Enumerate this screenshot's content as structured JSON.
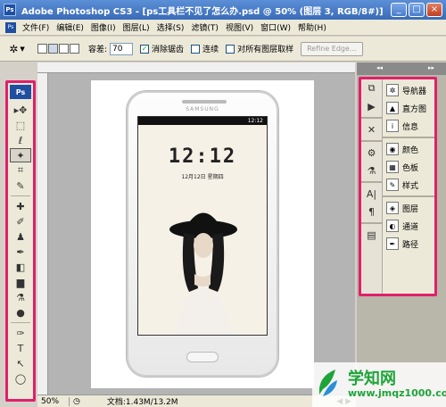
{
  "window": {
    "app_icon": "Ps",
    "title": "Adobe Photoshop CS3 - [ps工具栏不见了怎么办.psd @ 50% (图层 3, RGB/8#)]",
    "min": "_",
    "max": "□",
    "close": "×"
  },
  "menu": {
    "items": [
      "文件(F)",
      "编辑(E)",
      "图像(I)",
      "图层(L)",
      "选择(S)",
      "滤镜(T)",
      "视图(V)",
      "窗口(W)",
      "帮助(H)"
    ]
  },
  "options": {
    "tolerance_label": "容差:",
    "tolerance_value": "70",
    "antialias_label": "消除锯齿",
    "antialias_checked": true,
    "contiguous_label": "连续",
    "contiguous_checked": false,
    "all_layers_label": "对所有图层取样",
    "all_layers_checked": false,
    "refine_edge_label": "Refine Edge..."
  },
  "toolbox": {
    "logo": "Ps",
    "tools": [
      "▸✥",
      "⬚",
      "ℓ",
      "✦",
      "⌗",
      "✎",
      "✚",
      "✐",
      "♟",
      "✒",
      "◧",
      "▆",
      "⚗",
      "●",
      "✑",
      "T",
      "↖",
      "◯"
    ]
  },
  "document": {
    "phone_brand": "SAMSUNG",
    "status_time": "12:12",
    "clock": "12:12",
    "date": "12月12日  星期四"
  },
  "panels": {
    "icon_glyphs": [
      "⧉",
      "▶",
      "✕",
      "⚙",
      "⚗",
      "A|",
      "¶",
      "▤"
    ],
    "groups": [
      [
        {
          "icon": "✲",
          "label": "导航器"
        },
        {
          "icon": "▲",
          "label": "直方图"
        },
        {
          "icon": "i",
          "label": "信息"
        }
      ],
      [
        {
          "icon": "◉",
          "label": "颜色"
        },
        {
          "icon": "▦",
          "label": "色板"
        },
        {
          "icon": "✎",
          "label": "样式"
        }
      ],
      [
        {
          "icon": "◈",
          "label": "图层"
        },
        {
          "icon": "◐",
          "label": "通道"
        },
        {
          "icon": "✒",
          "label": "路径"
        }
      ]
    ]
  },
  "status": {
    "zoom": "50%",
    "doc_info": "文档:1.43M/13.2M",
    "nav": "◀ ▶"
  },
  "watermark": {
    "brand": "学知网",
    "url": "www.jmqz1000.com"
  }
}
